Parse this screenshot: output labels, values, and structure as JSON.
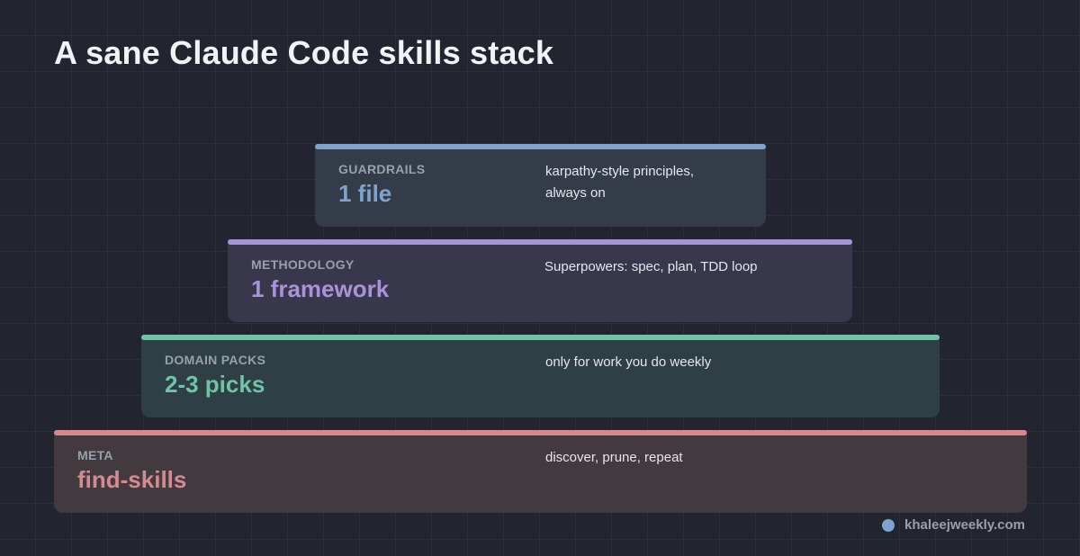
{
  "title": "A sane Claude Code skills stack",
  "layers": [
    {
      "tag": "GUARDRAILS",
      "value": "1 file",
      "desc_lines": [
        "karpathy-style principles,",
        "always on"
      ],
      "color": "#7ea3cf"
    },
    {
      "tag": "METHODOLOGY",
      "value": "1 framework",
      "desc_lines": [
        "Superpowers: spec, plan, TDD loop"
      ],
      "color": "#a993d8"
    },
    {
      "tag": "DOMAIN PACKS",
      "value": "2-3 picks",
      "desc_lines": [
        "only for work you do weekly"
      ],
      "color": "#72c2a7"
    },
    {
      "tag": "META",
      "value": "find-skills",
      "desc_lines": [
        "discover, prune, repeat"
      ],
      "color": "#d58a92"
    }
  ],
  "footer": {
    "site": "khaleejweekly.com",
    "dot_icon": "circle-dot-icon"
  }
}
